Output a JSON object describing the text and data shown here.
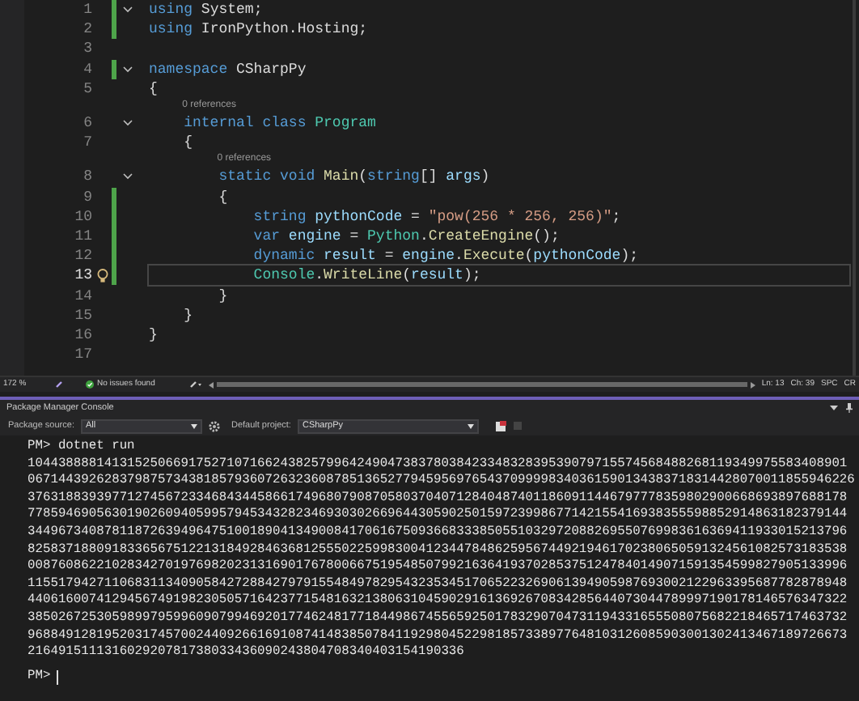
{
  "editor": {
    "lines": [
      {
        "n": "1",
        "fold": true,
        "changed": true,
        "current": false,
        "tokens": [
          {
            "t": "using",
            "kind": "kw"
          },
          {
            "t": " System;",
            "kind": "plain"
          }
        ]
      },
      {
        "n": "2",
        "fold": false,
        "changed": true,
        "current": false,
        "tokens": [
          {
            "t": "using",
            "kind": "kw"
          },
          {
            "t": " IronPython.Hosting;",
            "kind": "plain"
          }
        ]
      },
      {
        "n": "3",
        "fold": false,
        "changed": false,
        "current": false
      },
      {
        "n": "4",
        "fold": true,
        "changed": true,
        "current": false,
        "tokens": [
          {
            "t": "namespace",
            "kind": "kw"
          },
          {
            "t": " CSharpPy",
            "kind": "plain"
          }
        ]
      },
      {
        "n": "5",
        "fold": false,
        "changed": false,
        "current": false,
        "tokens": [
          {
            "t": "{",
            "kind": "plain"
          }
        ]
      },
      {
        "n": "6",
        "codelens": "0 references",
        "fold": true,
        "changed": false,
        "current": false,
        "tokens": [
          {
            "t": "    internal class",
            "kind": "kw"
          },
          {
            "t": " Program",
            "kind": "type"
          }
        ]
      },
      {
        "n": "7",
        "fold": false,
        "changed": false,
        "current": false,
        "tokens": [
          {
            "t": "    {",
            "kind": "plain"
          }
        ]
      },
      {
        "n": "8",
        "codelens": "0 references",
        "fold": true,
        "changed": false,
        "current": false,
        "tokens": [
          {
            "t": "        static void",
            "kind": "kw"
          },
          {
            "t": " Main",
            "kind": "method"
          },
          {
            "t": "(",
            "kind": "plain"
          },
          {
            "t": "string",
            "kind": "kw"
          },
          {
            "t": "[] ",
            "kind": "plain"
          },
          {
            "t": "args",
            "kind": "param"
          },
          {
            "t": ")",
            "kind": "plain"
          }
        ]
      },
      {
        "n": "9",
        "fold": false,
        "changed": true,
        "current": false,
        "tokens": [
          {
            "t": "        {",
            "kind": "plain"
          }
        ]
      },
      {
        "n": "10",
        "fold": false,
        "changed": true,
        "current": false,
        "tokens": [
          {
            "t": "            string",
            "kind": "kw"
          },
          {
            "t": " pythonCode",
            "kind": "param"
          },
          {
            "t": " = ",
            "kind": "plain"
          },
          {
            "t": "\"pow(256 * 256, 256)\"",
            "kind": "str"
          },
          {
            "t": ";",
            "kind": "plain"
          }
        ]
      },
      {
        "n": "11",
        "fold": false,
        "changed": true,
        "current": false,
        "tokens": [
          {
            "t": "            var",
            "kind": "kw"
          },
          {
            "t": " engine",
            "kind": "param"
          },
          {
            "t": " = ",
            "kind": "plain"
          },
          {
            "t": "Python",
            "kind": "type"
          },
          {
            "t": ".",
            "kind": "plain"
          },
          {
            "t": "CreateEngine",
            "kind": "method"
          },
          {
            "t": "();",
            "kind": "plain"
          }
        ]
      },
      {
        "n": "12",
        "fold": false,
        "changed": true,
        "current": false,
        "tokens": [
          {
            "t": "            dynamic",
            "kind": "kw"
          },
          {
            "t": " result",
            "kind": "param"
          },
          {
            "t": " = ",
            "kind": "plain"
          },
          {
            "t": "engine",
            "kind": "param"
          },
          {
            "t": ".",
            "kind": "plain"
          },
          {
            "t": "Execute",
            "kind": "method"
          },
          {
            "t": "(",
            "kind": "plain"
          },
          {
            "t": "pythonCode",
            "kind": "param"
          },
          {
            "t": ");",
            "kind": "plain"
          }
        ]
      },
      {
        "n": "13",
        "fold": false,
        "changed": true,
        "current": true,
        "tokens": [
          {
            "t": "            Console",
            "kind": "type"
          },
          {
            "t": ".",
            "kind": "plain"
          },
          {
            "t": "WriteLine",
            "kind": "method"
          },
          {
            "t": "(",
            "kind": "plain"
          },
          {
            "t": "result",
            "kind": "param"
          },
          {
            "t": ");",
            "kind": "plain"
          }
        ]
      },
      {
        "n": "14",
        "fold": false,
        "changed": false,
        "current": false,
        "tokens": [
          {
            "t": "        }",
            "kind": "plain"
          }
        ]
      },
      {
        "n": "15",
        "fold": false,
        "changed": false,
        "current": false,
        "tokens": [
          {
            "t": "    }",
            "kind": "plain"
          }
        ]
      },
      {
        "n": "16",
        "fold": false,
        "changed": false,
        "current": false,
        "tokens": [
          {
            "t": "}",
            "kind": "plain"
          }
        ]
      },
      {
        "n": "17",
        "fold": false,
        "changed": false,
        "current": false
      }
    ]
  },
  "status_bar": {
    "zoom": "172 %",
    "issues": "No issues found",
    "line": "Ln: 13",
    "column": "Ch: 39",
    "whitespace": "SPC",
    "line_ending": "CR"
  },
  "console_panel": {
    "title": "Package Manager Console",
    "source_label": "Package source:",
    "source_value": "All",
    "project_label": "Default project:",
    "project_value": "CSharpPy",
    "lines": [
      "PM> dotnet run",
      "10443888814131525066917527107166243825799642490473837803842334832839539079715574568488268119349975583408901",
      "067144392628379875734381857936072632360878513652779459569765437099998340361590134383718314428070011855946226",
      "37631883939771274567233468434458661749680790870580370407128404874011860911446797778359802900668693897688178",
      "77859469056301902609405995794534328234693030266964430590250159723998677142155416938355598852914863182379144",
      "34496734087811872639496475100189041349008417061675093668333850551032972088269550769983616369411933015213796",
      "82583718809183365675122131849284636812555022599830041234478486259567449219461702380650591324561082573183538",
      "00876086221028342701976982023131690176780066751954850799216364193702853751247840149071591354599827905133996",
      "11551794271106831134090584272884279791554849782954323534517065223269061394905987693002122963395687782878948",
      "44061600741294567491982305057164237715481632138063104590291613692670834285644073044789997190178146576347322",
      "38502672530598997959960907994692017746248177184498674556592501783290704731194331655508075682218465717463732",
      "96884912819520317457002440926616910874148385078411929804522981857338977648103126085903001302413467189726673",
      "216491511131602920781738033436090243804708340403154190336"
    ],
    "prompt": "PM>"
  }
}
